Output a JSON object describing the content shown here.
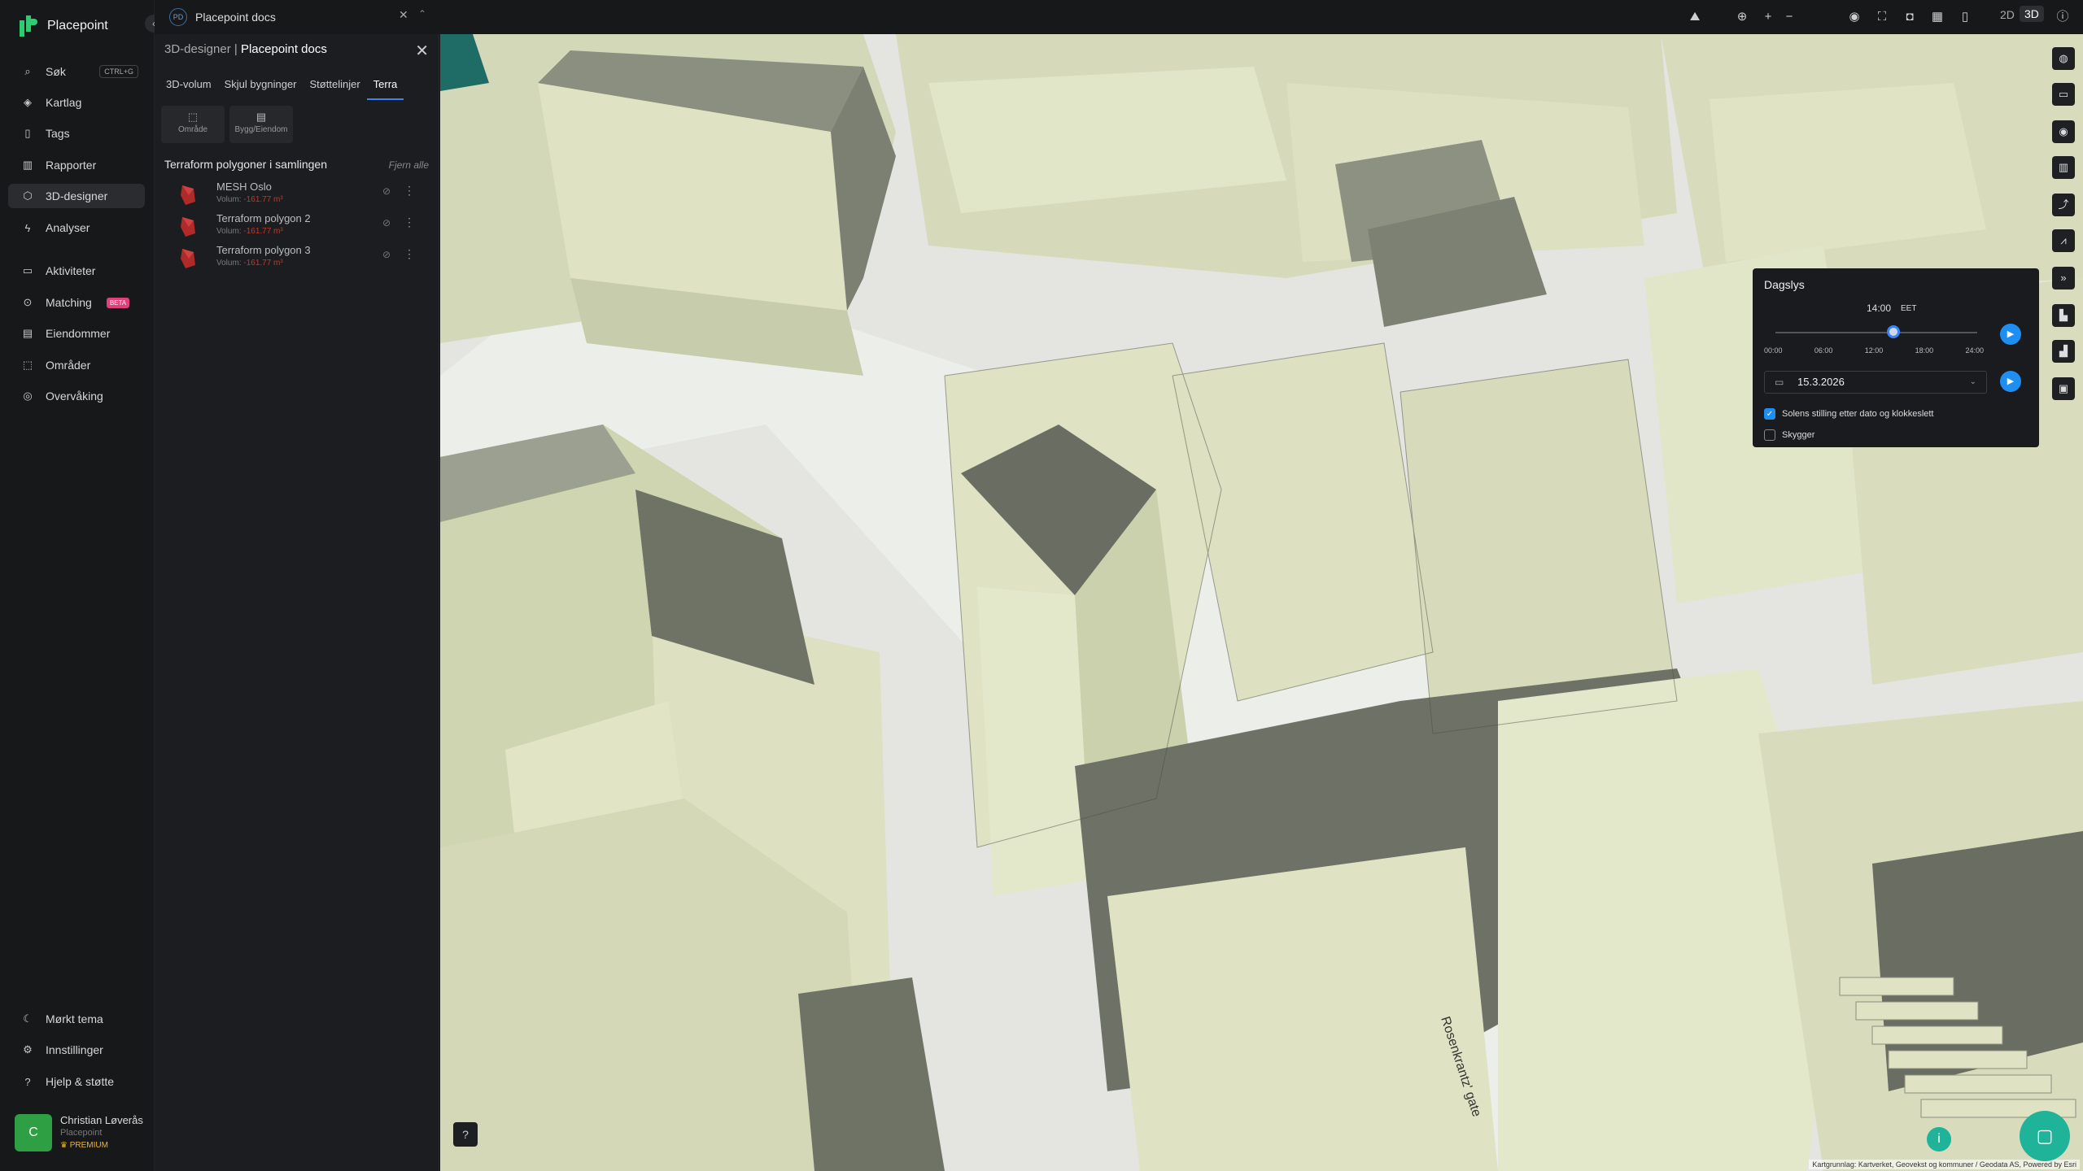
{
  "app": {
    "name": "Placepoint"
  },
  "nav": {
    "items": [
      {
        "label": "Søk",
        "icon": "search-icon",
        "shortcut": "CTRL+G"
      },
      {
        "label": "Kartlag",
        "icon": "layers-icon"
      },
      {
        "label": "Tags",
        "icon": "bookmark-icon"
      },
      {
        "label": "Rapporter",
        "icon": "bar-chart-icon"
      },
      {
        "label": "3D-designer",
        "icon": "cube-icon",
        "active": true
      },
      {
        "label": "Analyser",
        "icon": "bolt-icon"
      },
      {
        "label": "Aktiviteter",
        "icon": "message-icon"
      },
      {
        "label": "Matching",
        "icon": "match-icon",
        "badge": "BETA"
      },
      {
        "label": "Eiendommer",
        "icon": "building-icon"
      },
      {
        "label": "Områder",
        "icon": "area-icon"
      },
      {
        "label": "Overvåking",
        "icon": "radar-icon"
      }
    ],
    "bottom": [
      {
        "label": "Mørkt tema",
        "icon": "moon-icon"
      },
      {
        "label": "Innstillinger",
        "icon": "gear-icon"
      },
      {
        "label": "Hjelp & støtte",
        "icon": "help-icon"
      }
    ],
    "user": {
      "initial": "C",
      "name": "Christian Løverås",
      "org": "Placepoint",
      "plan": "PREMIUM"
    }
  },
  "topbar": {
    "doc_badge": "PD",
    "doc_title": "Placepoint docs",
    "view_2d": "2D",
    "view_3d": "3D"
  },
  "panel": {
    "crumb_section": "3D-designer",
    "crumb_title": "Placepoint docs",
    "tabs": [
      "3D-volum",
      "Skjul bygninger",
      "Støttelinjer",
      "Terra"
    ],
    "active_tab": "Terra",
    "sub_buttons": [
      "Område",
      "Bygg/Eiendom"
    ],
    "section_title": "Terraform polygoner i samlingen",
    "section_action": "Fjern alle",
    "volume_label": "Volum:",
    "polygons": [
      {
        "name": "MESH Oslo",
        "volume": "-161.77 m³"
      },
      {
        "name": "Terraform polygon 2",
        "volume": "-161.77 m³"
      },
      {
        "name": "Terraform polygon 3",
        "volume": "-161.77 m³"
      }
    ]
  },
  "daylight": {
    "title": "Dagslys",
    "time": "14:00",
    "tz": "EET",
    "time_fraction": 0.583,
    "ticks": [
      "00:00",
      "06:00",
      "12:00",
      "18:00",
      "24:00"
    ],
    "date": "15.3.2026",
    "sun_position_label": "Solens stilling etter dato og klokkeslett",
    "sun_position_checked": true,
    "shadows_label": "Skygger",
    "shadows_checked": false
  },
  "map": {
    "attribution": "Kartgrunnlag: Kartverket, Geovekst og kommuner / Geodata AS, Powered by Esri",
    "street_label": "Rosenkrantz' gate"
  },
  "colors": {
    "accent": "#1f8ef1",
    "brand": "#2ecc71",
    "building_light": "#dfe3c3",
    "building_dark": "#6b6f63",
    "polygon": "#c0392b"
  }
}
